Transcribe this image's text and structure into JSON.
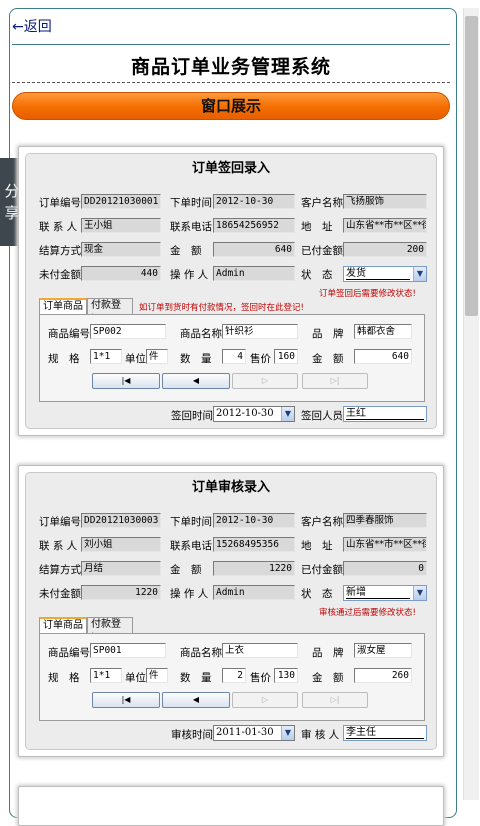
{
  "nav": {
    "back": "←返回"
  },
  "header": {
    "title": "商品订单业务管理系统",
    "banner": "窗口展示",
    "share": "分享"
  },
  "cards": [
    {
      "title": "订单签回录入",
      "labels": {
        "order_no": "订单编号",
        "order_time": "下单时间",
        "customer": "客户名称",
        "contact": "联 系 人",
        "phone": "联系电话",
        "address": "地　址",
        "payment": "结算方式",
        "amount": "金　额",
        "paid": "已付金额",
        "unpaid": "未付金额",
        "operator": "操 作 人",
        "status": "状　态"
      },
      "values": {
        "order_no": "DD20121030001",
        "order_time": "2012-10-30",
        "customer": "飞扬服饰",
        "contact": "王小姐",
        "phone": "18654256952",
        "address": "山东省**市**区**街",
        "payment": "现金",
        "amount": "640",
        "paid": "200",
        "unpaid": "440",
        "operator": "Admin",
        "status": "发货"
      },
      "status_note": "订单签回后需要修改状态!",
      "tabs": [
        "订单商品",
        "付款登记"
      ],
      "tab_note": "如订单到货时有付款情况，签回时在此登记!",
      "item_labels": {
        "code": "商品编号",
        "name": "商品名称",
        "brand": "品　牌",
        "spec": "规　格",
        "unit": "单位",
        "qty": "数　量",
        "price": "售价",
        "total": "金　额"
      },
      "item_values": {
        "code": "SP002",
        "name": "针织衫",
        "brand": "韩都衣舍",
        "spec": "1*1",
        "unit": "件",
        "qty": "4",
        "price": "160",
        "total": "640"
      },
      "nav_buttons": [
        "|◀",
        "◀",
        "▷",
        "▷|"
      ],
      "bottom": {
        "label1": "签回时间",
        "value1": "2012-10-30",
        "label2": "签回人员",
        "value2": "王红"
      }
    },
    {
      "title": "订单审核录入",
      "labels": {
        "order_no": "订单编号",
        "order_time": "下单时间",
        "customer": "客户名称",
        "contact": "联 系 人",
        "phone": "联系电话",
        "address": "地　址",
        "payment": "结算方式",
        "amount": "金　额",
        "paid": "已付金额",
        "unpaid": "未付金额",
        "operator": "操 作 人",
        "status": "状　态"
      },
      "values": {
        "order_no": "DD20121030003",
        "order_time": "2012-10-30",
        "customer": "四季春服饰",
        "contact": "刘小姐",
        "phone": "15268495356",
        "address": "山东省**市**区**街",
        "payment": "月结",
        "amount": "1220",
        "paid": "0",
        "unpaid": "1220",
        "operator": "Admin",
        "status": "新增"
      },
      "status_note": "审核通过后需要修改状态!",
      "tabs": [
        "订单商品",
        "付款登记"
      ],
      "tab_note": "",
      "item_labels": {
        "code": "商品编号",
        "name": "商品名称",
        "brand": "品　牌",
        "spec": "规　格",
        "unit": "单位",
        "qty": "数　量",
        "price": "售价",
        "total": "金　额"
      },
      "item_values": {
        "code": "SP001",
        "name": "上衣",
        "brand": "淑女屋",
        "spec": "1*1",
        "unit": "件",
        "qty": "2",
        "price": "130",
        "total": "260"
      },
      "nav_buttons": [
        "|◀",
        "◀",
        "▷",
        "▷|"
      ],
      "bottom": {
        "label1": "审核时间",
        "value1": "2011-01-30",
        "label2": "审 核 人",
        "value2": "李主任"
      }
    }
  ]
}
